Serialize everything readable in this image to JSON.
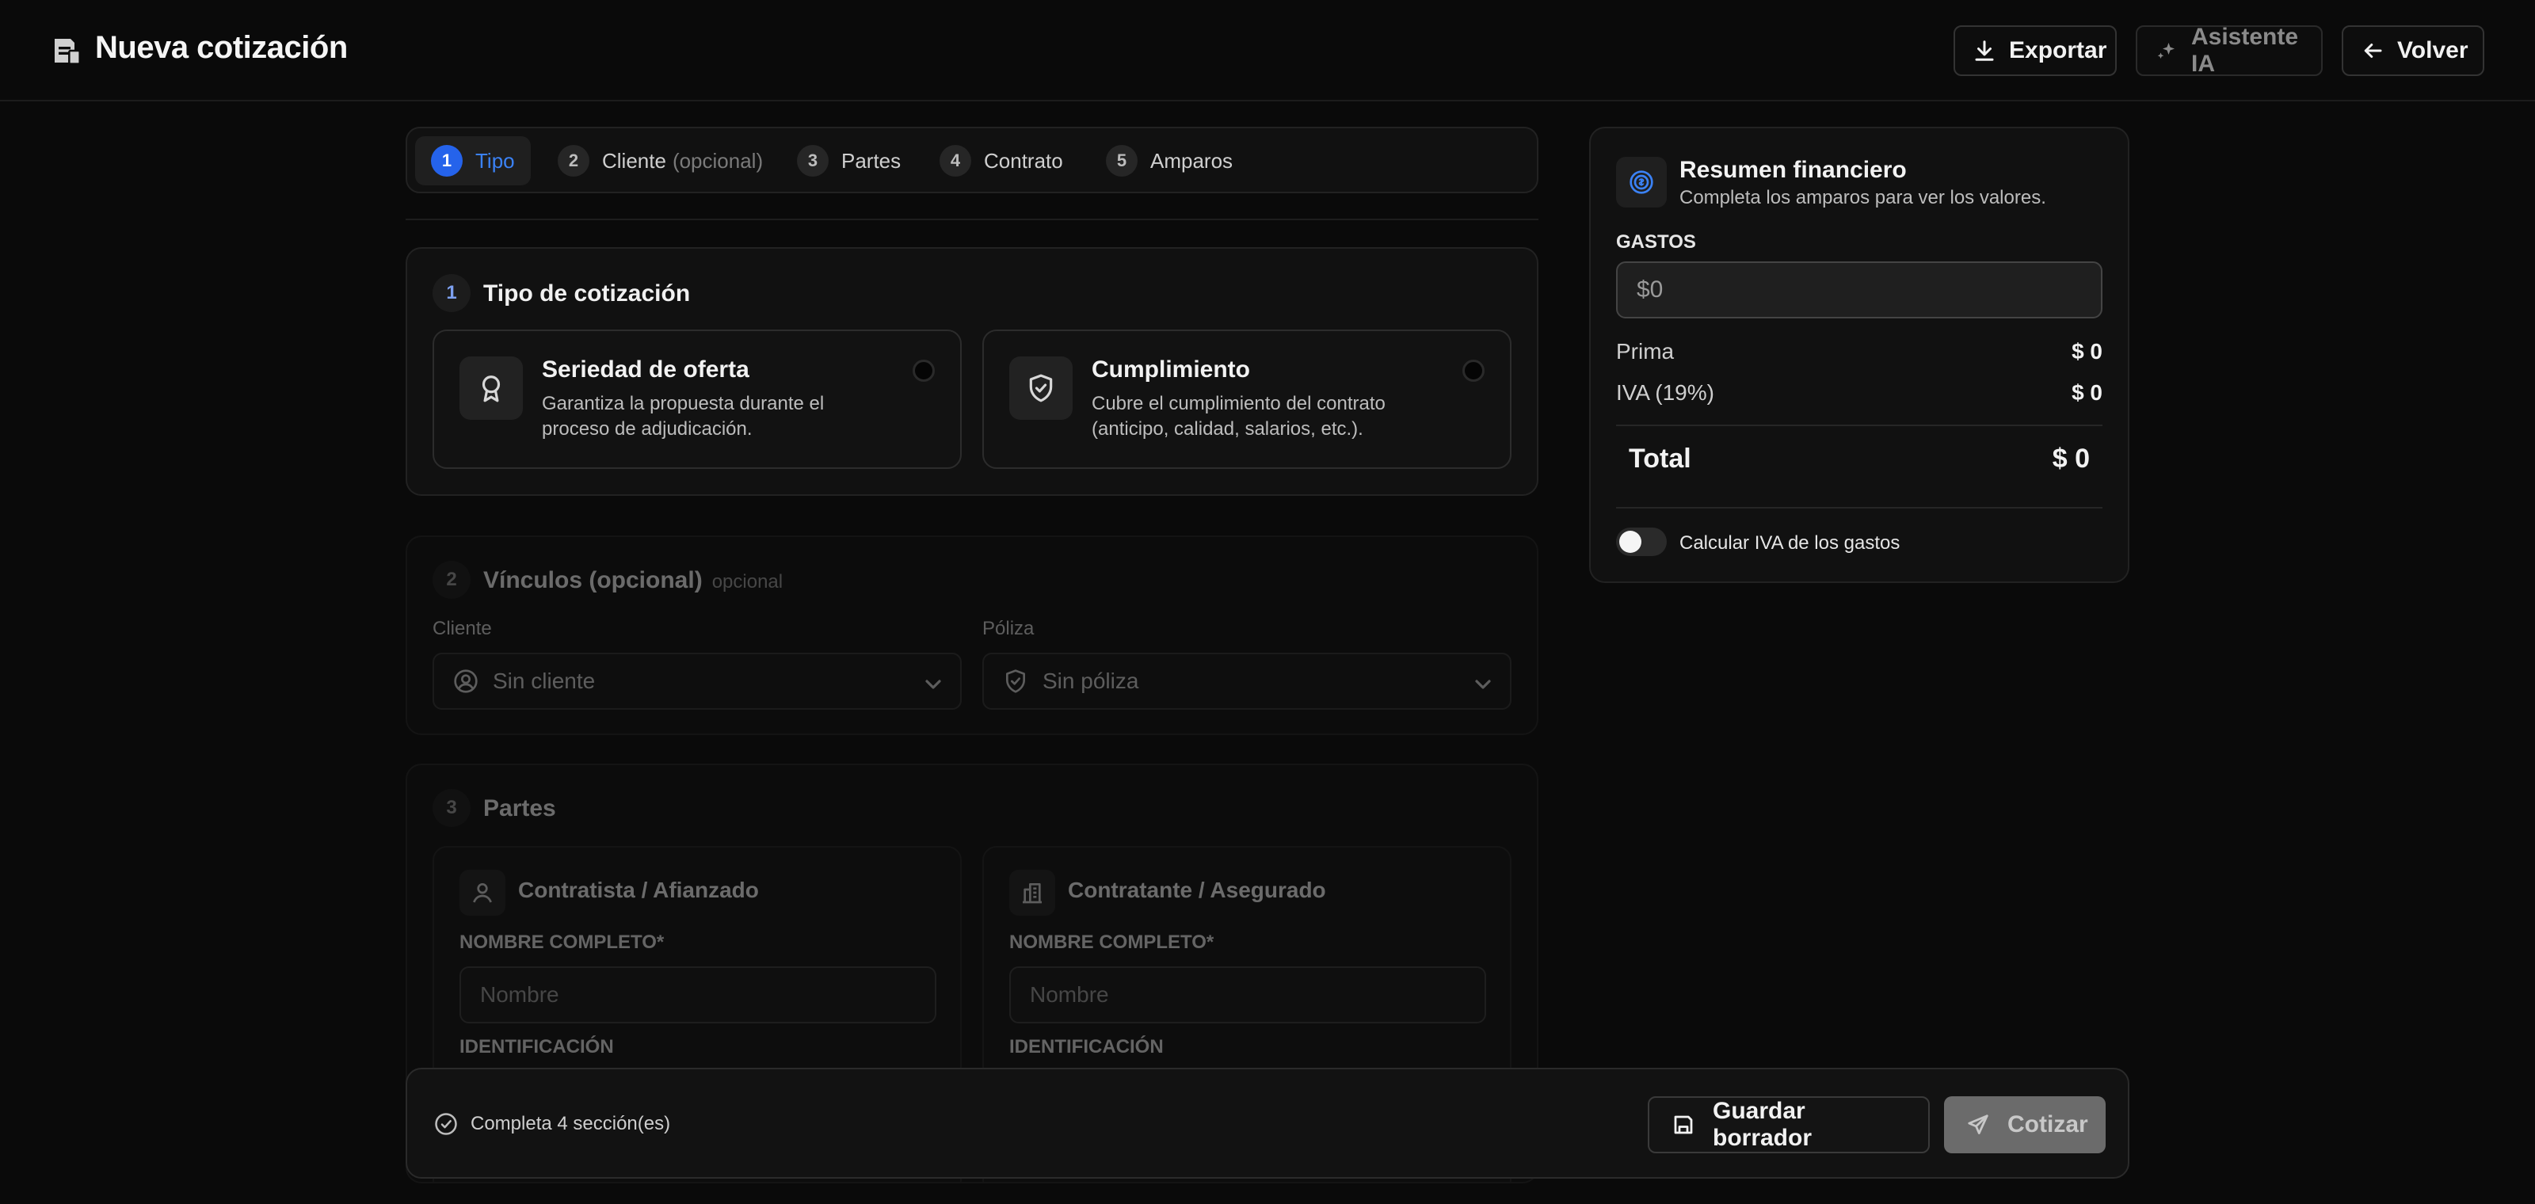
{
  "header": {
    "title": "Nueva cotización",
    "export_label": "Exportar",
    "ai_label": "Asistente IA",
    "back_label": "Volver"
  },
  "stepper": {
    "steps": [
      {
        "num": "1",
        "label": "Tipo",
        "suffix": ""
      },
      {
        "num": "2",
        "label": "Cliente",
        "suffix": "(opcional)"
      },
      {
        "num": "3",
        "label": "Partes",
        "suffix": ""
      },
      {
        "num": "4",
        "label": "Contrato",
        "suffix": ""
      },
      {
        "num": "5",
        "label": "Amparos",
        "suffix": ""
      }
    ],
    "active_index": 0
  },
  "section1": {
    "num": "1",
    "title": "Tipo de cotización",
    "options": [
      {
        "title": "Seriedad de oferta",
        "description": "Garantiza la propuesta durante el proceso de adjudicación."
      },
      {
        "title": "Cumplimiento",
        "description": "Cubre el cumplimiento del contrato (anticipo, calidad, salarios, etc.)."
      }
    ]
  },
  "section2": {
    "num": "2",
    "title": "Vínculos (opcional)",
    "optional_tag": "opcional",
    "client_label": "Cliente",
    "client_value": "Sin cliente",
    "policy_label": "Póliza",
    "policy_value": "Sin póliza"
  },
  "section3": {
    "num": "3",
    "title": "Partes",
    "parties": [
      {
        "title": "Contratista / Afianzado",
        "name_label": "NOMBRE COMPLETO*",
        "name_placeholder": "Nombre",
        "id_label": "IDENTIFICACIÓN"
      },
      {
        "title": "Contratante / Asegurado",
        "name_label": "NOMBRE COMPLETO*",
        "name_placeholder": "Nombre",
        "id_label": "IDENTIFICACIÓN"
      }
    ]
  },
  "summary": {
    "title": "Resumen financiero",
    "subtitle": "Completa los amparos para ver los valores.",
    "expenses_label": "GASTOS",
    "expenses_value": "$0",
    "rows": [
      {
        "label": "Prima",
        "value": "$ 0"
      },
      {
        "label": "IVA (19%)",
        "value": "$ 0"
      }
    ],
    "total_label": "Total",
    "total_value": "$ 0",
    "toggle_label": "Calcular IVA de los gastos",
    "toggle_on": false
  },
  "actionbar": {
    "status": "Completa 4 sección(es)",
    "save_label": "Guardar borrador",
    "quote_label": "Cotizar"
  },
  "colors": {
    "background": "#0a0a0a",
    "accent": "#3b82f6",
    "card": "#111111"
  }
}
